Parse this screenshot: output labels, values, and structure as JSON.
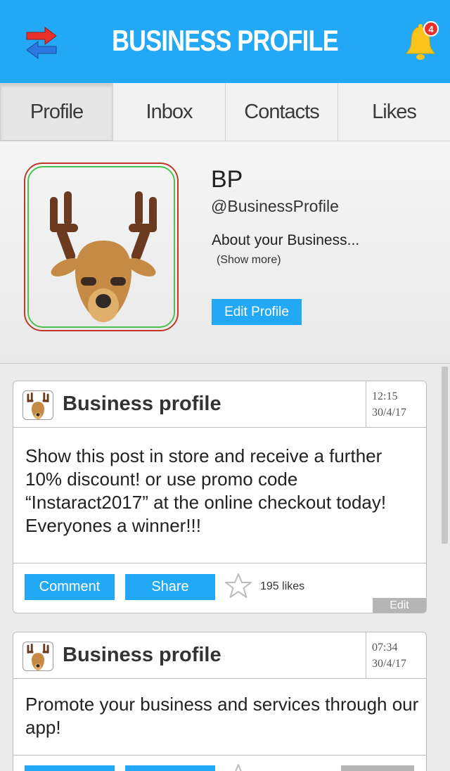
{
  "header": {
    "title": "BUSINESS PROFILE",
    "notification_count": "4",
    "accent_color": "#23a8f5"
  },
  "tabs": [
    {
      "label": "Profile",
      "active": true
    },
    {
      "label": "Inbox",
      "active": false
    },
    {
      "label": "Contacts",
      "active": false
    },
    {
      "label": "Likes",
      "active": false
    }
  ],
  "profile": {
    "name": "BP",
    "handle": "@BusinessProfile",
    "about": "About your Business...",
    "show_more": "(Show more)",
    "edit_button": "Edit Profile",
    "avatar_icon": "deer-icon"
  },
  "posts": [
    {
      "author": "Business profile",
      "time": "12:15",
      "date": "30/4/17",
      "body": "Show this post in store and receive a further 10% discount! or use promo code “Instaract2017” at the online checkout today!\n Everyones a winner!!!",
      "comment_label": "Comment",
      "share_label": "Share",
      "likes": "195 likes",
      "edit_label": "Edit"
    },
    {
      "author": "Business profile",
      "time": "07:34",
      "date": "30/4/17",
      "body": "Promote your business and services through our app!"
    }
  ]
}
